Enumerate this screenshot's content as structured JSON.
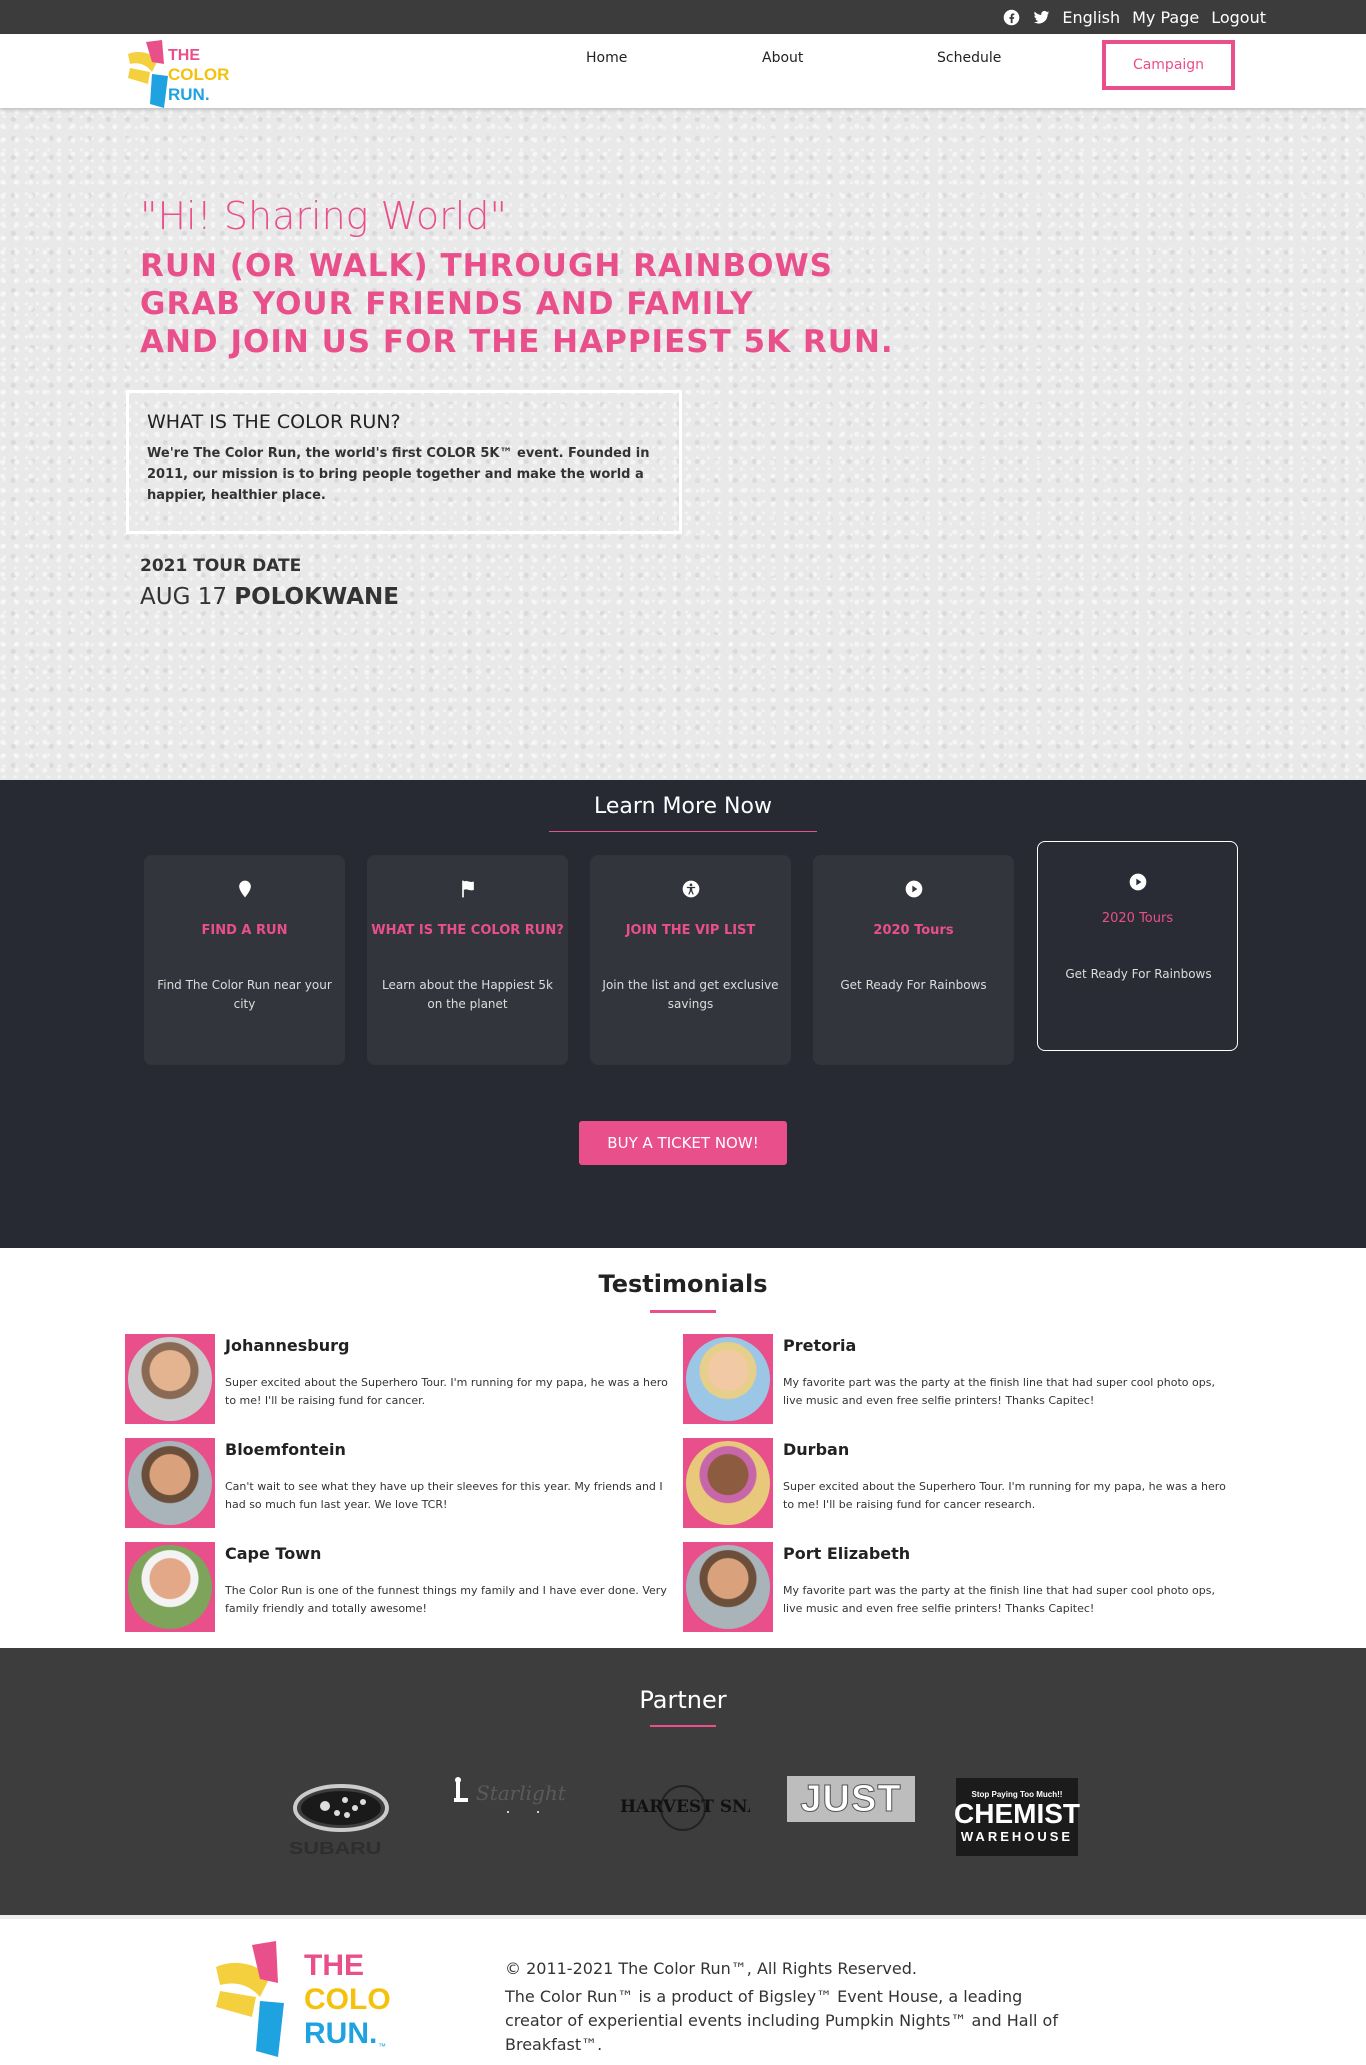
{
  "topbar": {
    "language": "English",
    "mypage": "My Page",
    "logout": "Logout"
  },
  "nav": {
    "items": [
      "Home",
      "About",
      "Schedule"
    ],
    "campaign": "Campaign"
  },
  "logo": {
    "line1": "THE",
    "line2": "COLOR",
    "line3": "RUN.",
    "tm": "™"
  },
  "hero": {
    "greeting": "\"Hi! Sharing World\"",
    "tagline": [
      "RUN (OR WALK) THROUGH RAINBOWS",
      "GRAB YOUR FRIENDS AND FAMILY",
      "AND JOIN US FOR THE HAPPIEST 5K RUN."
    ],
    "what_title": "WHAT IS THE COLOR RUN?",
    "what_text": "We're The Color Run, the world's first COLOR 5K™ event. Founded in 2011, our mission is to bring people together and make the world a happier, healthier place.",
    "tour_label": "2021 TOUR DATE",
    "tour_date": "AUG 17",
    "tour_city": "POLOKWANE"
  },
  "learn": {
    "heading": "Learn More Now",
    "cards": [
      {
        "icon": "map-pin-icon",
        "title": "FIND A RUN",
        "desc": "Find The Color Run near your city"
      },
      {
        "icon": "flag-icon",
        "title": "WHAT IS THE COLOR RUN?",
        "desc": "Learn about the Happiest 5k on the planet"
      },
      {
        "icon": "accessibility-icon",
        "title": "JOIN THE VIP LIST",
        "desc": "Join the list and get exclusive savings"
      },
      {
        "icon": "play-icon",
        "title": "2020 Tours",
        "desc": "Get Ready For Rainbows"
      },
      {
        "icon": "play-icon",
        "title": "2020 Tours",
        "desc": "Get Ready For Rainbows"
      }
    ],
    "buy": "BUY A TICKET NOW!"
  },
  "testimonials": {
    "heading": "Testimonials",
    "items": [
      {
        "name": "Johannesburg",
        "text": "Super excited about the Superhero Tour. I'm running for my papa, he was a hero to me! I'll be raising fund for cancer."
      },
      {
        "name": "Pretoria",
        "text": "My favorite part was the party at the finish line that had super cool photo ops, live music and even free selfie printers! Thanks Capitec!"
      },
      {
        "name": "Bloemfontein",
        "text": "Can't wait to see what they have up their sleeves for this year. My friends and I had so much fun last year. We love TCR!"
      },
      {
        "name": "Durban",
        "text": "Super excited about the Superhero Tour. I'm running for my papa, he was a hero to me! I'll be raising fund for cancer research."
      },
      {
        "name": "Cape Town",
        "text": "The Color Run is one of the funnest things my family and I have ever done. Very family friendly and totally awesome!"
      },
      {
        "name": "Port Elizabeth",
        "text": "My favorite part was the party at the finish line that had super cool photo ops, live music and even free selfie printers! Thanks Capitec!"
      }
    ]
  },
  "partner": {
    "heading": "Partner",
    "logos": [
      "SUBARU",
      "Starlight",
      "HARVEST SNAPS",
      "JUST",
      "Stop Paying Too Much!!",
      "CHEMIST",
      "WAREHOUSE"
    ]
  },
  "footer": {
    "copyright": "© 2011-2021 The Color Run™, All Rights Reserved.",
    "desc": "The Color Run™ is a product of Bigsley™ Event House, a leading creator of experiential events including Pumpkin Nights™ and Hall of Breakfast™."
  },
  "colors": {
    "accent": "#e94f8b",
    "dark": "#272a33",
    "topbar": "#3c3c3c",
    "partner": "#3d3d3d"
  }
}
